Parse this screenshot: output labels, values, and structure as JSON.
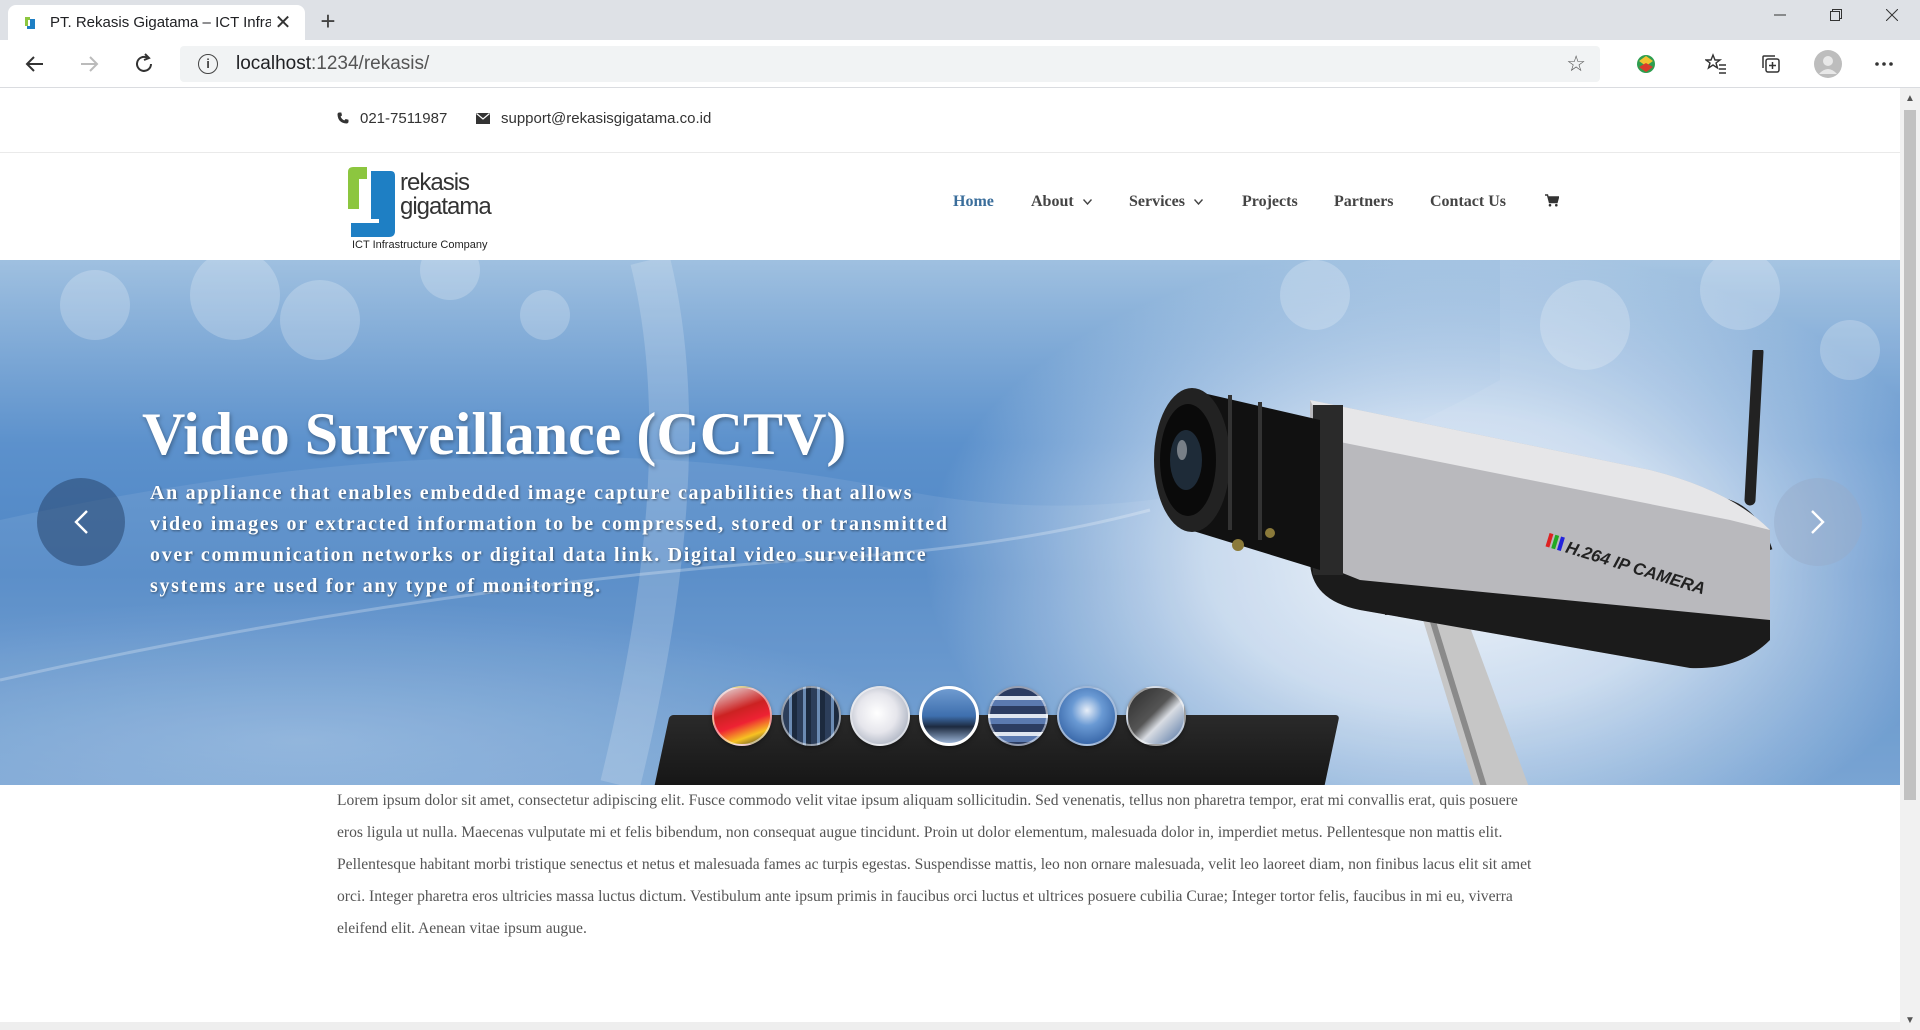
{
  "browser": {
    "tab_title": "PT. Rekasis Gigatama – ICT Infrastructure Company",
    "tab_close": "✕",
    "new_tab": "+",
    "url_host": "localhost",
    "url_path": ":1234/rekasis/",
    "icons": [
      "back-icon",
      "forward-icon",
      "refresh-icon",
      "info-icon",
      "star-icon",
      "extension-icon",
      "favorites-icon",
      "collections-icon",
      "profile-icon",
      "more-icon"
    ]
  },
  "topbar": {
    "phone": "021-7511987",
    "email": "support@rekasisgigatama.co.id"
  },
  "logo": {
    "line1": "rekasis",
    "line2": "gigatama",
    "tagline": "ICT Infrastructure Company"
  },
  "nav": {
    "items": [
      {
        "label": "Home",
        "active": true
      },
      {
        "label": "About",
        "dropdown": true
      },
      {
        "label": "Services",
        "dropdown": true
      },
      {
        "label": "Projects"
      },
      {
        "label": "Partners"
      },
      {
        "label": "Contact Us"
      }
    ],
    "caret": "⌄",
    "cart_icon": "cart-icon"
  },
  "hero": {
    "title": "Video Surveillance (CCTV)",
    "description": "An appliance that enables embedded image capture capabilities that allows video images or extracted information to be compressed, stored or transmitted over communication networks or digital data link. Digital video surveillance systems are used for any type of monitoring.",
    "camera_label": "H.264 IP CAMERA",
    "active_slide": 4,
    "slide_count": 7
  },
  "content": {
    "paragraph": "Lorem ipsum dolor sit amet, consectetur adipiscing elit. Fusce commodo velit vitae ipsum aliquam sollicitudin. Sed venenatis, tellus non pharetra tempor, erat mi convallis erat, quis posuere eros ligula ut nulla. Maecenas vulputate mi et felis bibendum, non consequat augue tincidunt. Proin ut dolor elementum, malesuada dolor in, imperdiet metus. Pellentesque non mattis elit. Pellentesque habitant morbi tristique senectus et netus et malesuada fames ac turpis egestas. Suspendisse mattis, leo non ornare malesuada, velit leo laoreet diam, non finibus lacus elit sit amet orci. Integer pharetra eros ultricies massa luctus dictum. Vestibulum ante ipsum primis in faucibus orci luctus et ultrices posuere cubilia Curae; Integer tortor felis, faucibus in mi eu, viverra eleifend elit. Aenean vitae ipsum augue."
  },
  "colors": {
    "nav_active": "#3b6e9b",
    "logo_green": "#8cc63f",
    "logo_blue": "#1e7fc4"
  }
}
